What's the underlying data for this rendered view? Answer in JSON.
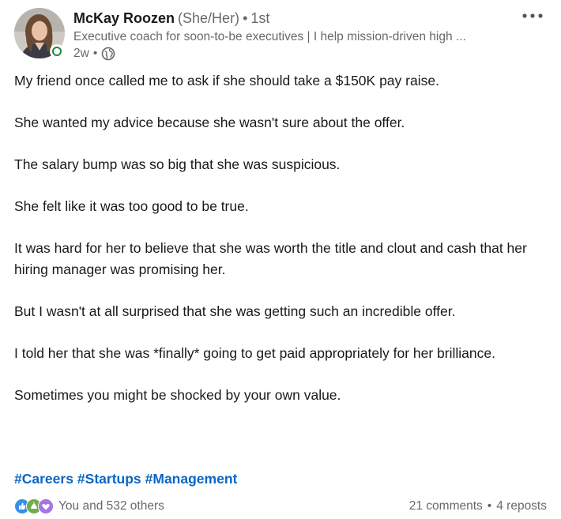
{
  "author": {
    "name": "McKay Roozen",
    "pronouns": "(She/Her)",
    "separator": "•",
    "degree": "1st",
    "headline": "Executive coach for soon-to-be executives | I help mission-driven high ...",
    "time": "2w",
    "time_separator": "•",
    "visibility_icon": "globe-icon",
    "presence_color": "#1a8a3c"
  },
  "menu": {
    "icon": "ellipsis-icon"
  },
  "post": {
    "paragraphs": [
      "My friend once called me to ask if she should take a $150K pay raise.",
      "She wanted my advice because she wasn't sure about the offer.",
      "The salary bump was so big that she was suspicious.",
      "She felt like it was too good to be true.",
      "It was hard for her to believe that she was worth the title and clout and cash that her hiring manager was promising her.",
      "But I wasn't at all surprised that she was getting such an incredible offer.",
      "I told her that she was *finally* going to get paid appropriately for her brilliance.",
      "Sometimes you might be shocked by your own value."
    ],
    "hashtags": [
      "#Careers",
      "#Startups",
      "#Management"
    ]
  },
  "social": {
    "reaction_icons": [
      "like-icon",
      "celebrate-icon",
      "support-icon"
    ],
    "reactions_text": "You and 532 others",
    "comments": "21 comments",
    "separator": "•",
    "reposts": "4 reposts"
  },
  "colors": {
    "link": "#0a66c2",
    "text": "#191919",
    "secondary": "#666666"
  }
}
